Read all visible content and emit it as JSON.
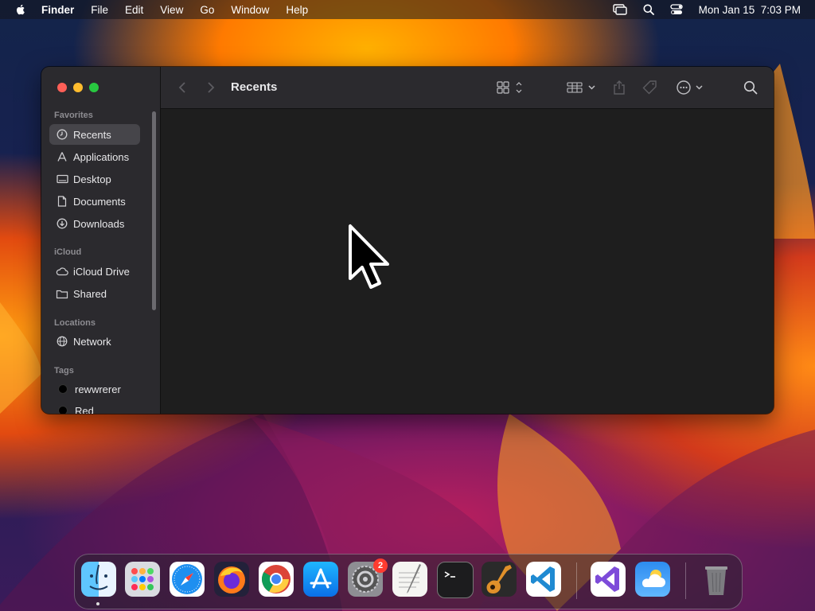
{
  "menubar": {
    "app_name": "Finder",
    "menus": [
      "File",
      "Edit",
      "View",
      "Go",
      "Window",
      "Help"
    ],
    "clock": "Mon Jan 15  7:03 PM"
  },
  "window": {
    "title": "Recents",
    "sidebar": {
      "favorites_heading": "Favorites",
      "favorites": [
        {
          "label": "Recents",
          "icon": "clock-icon"
        },
        {
          "label": "Applications",
          "icon": "applications-icon"
        },
        {
          "label": "Desktop",
          "icon": "desktop-icon"
        },
        {
          "label": "Documents",
          "icon": "document-icon"
        },
        {
          "label": "Downloads",
          "icon": "download-icon"
        }
      ],
      "icloud_heading": "iCloud",
      "icloud": [
        {
          "label": "iCloud Drive",
          "icon": "cloud-icon"
        },
        {
          "label": "Shared",
          "icon": "shared-folder-icon"
        }
      ],
      "locations_heading": "Locations",
      "locations": [
        {
          "label": "Network",
          "icon": "globe-icon"
        }
      ],
      "tags_heading": "Tags",
      "tags": [
        {
          "label": "rewwrerer",
          "color": "#000000"
        },
        {
          "label": "Red",
          "color": "#000000"
        }
      ]
    }
  },
  "dock": {
    "apps": [
      "Finder",
      "Launchpad",
      "Safari",
      "Firefox",
      "Google Chrome",
      "App Store",
      "System Settings",
      "TextEdit",
      "Terminal",
      "GarageBand",
      "Visual Studio Code",
      "Visual Studio",
      "Weather",
      "Trash"
    ],
    "system_settings_badge": "2"
  }
}
